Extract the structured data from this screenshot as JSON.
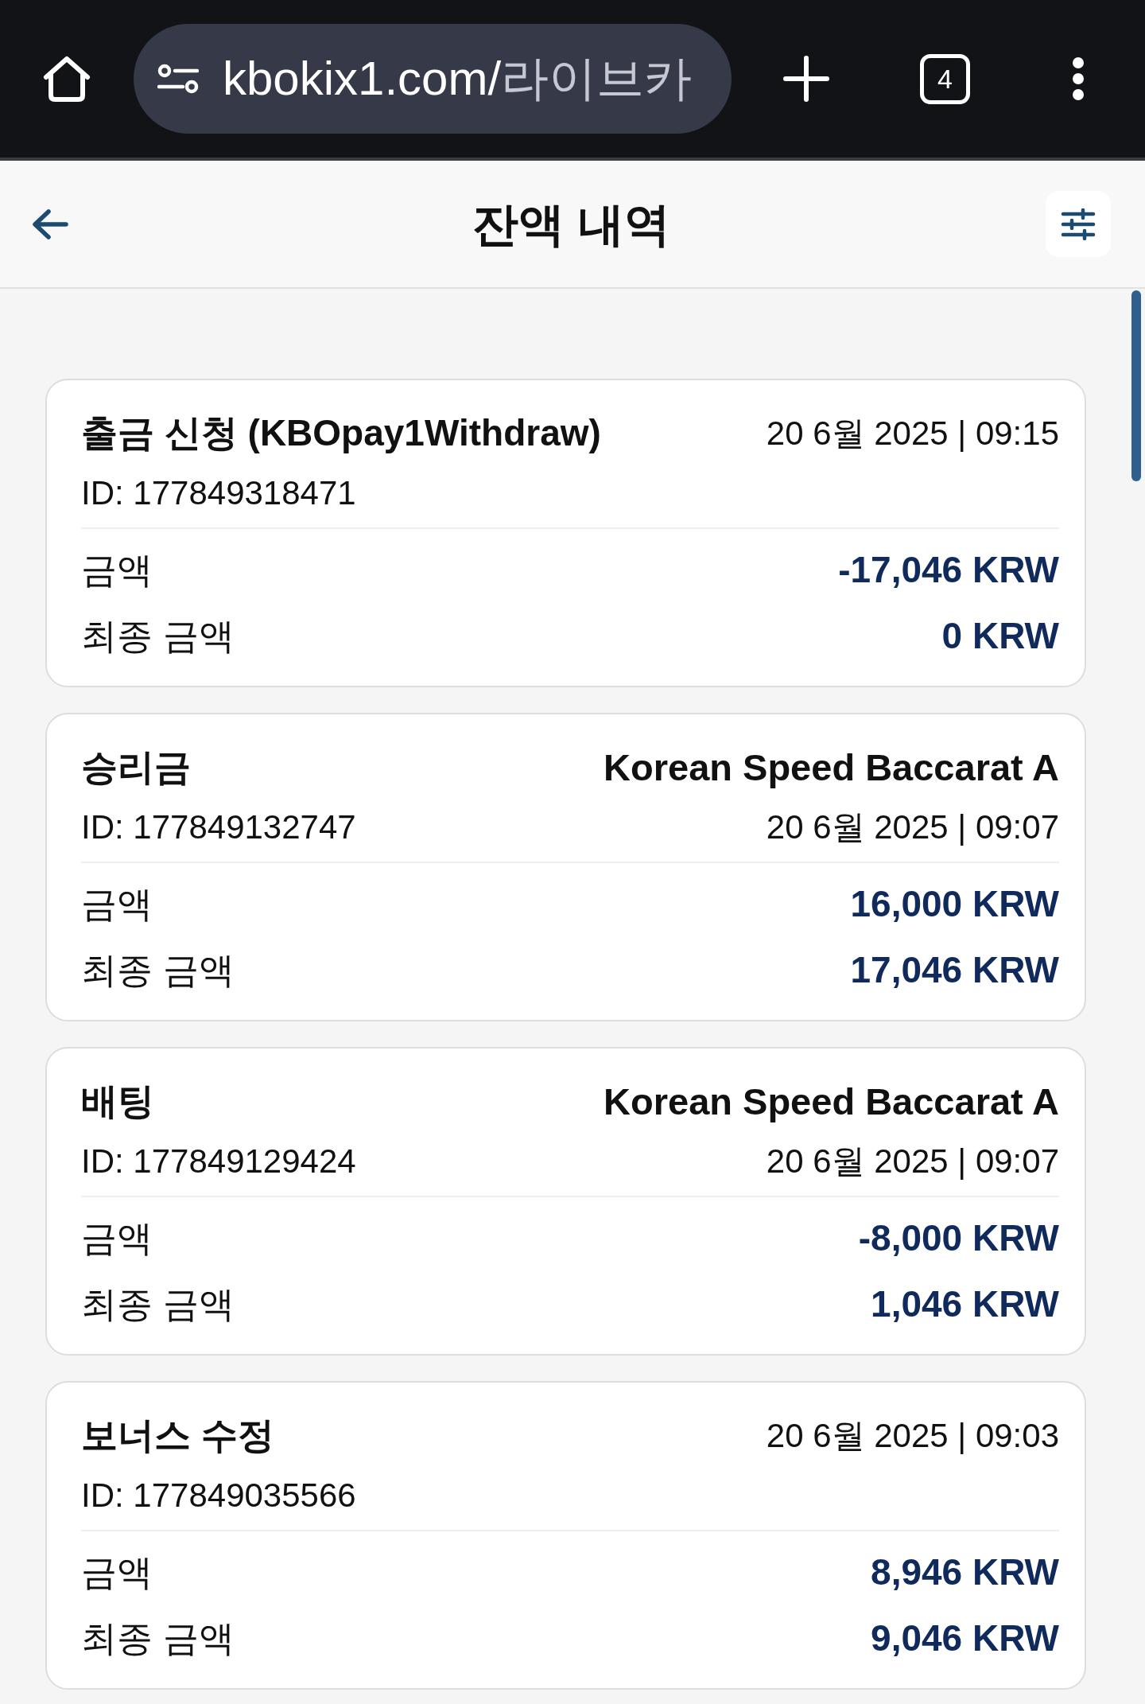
{
  "browser": {
    "address": {
      "domain": "kbokix1.com/",
      "path": "라이브카"
    },
    "tab_count": "4"
  },
  "header": {
    "title": "잔액 내역"
  },
  "transactions": [
    {
      "title": "출금 신청 (KBOpay1Withdraw)",
      "id": "ID: 177849318471",
      "date": "20 6월 2025 | 09:15",
      "rows": [
        {
          "label": "금액",
          "value": "-17,046 KRW"
        },
        {
          "label": "최종 금액",
          "value": "0 KRW"
        }
      ]
    },
    {
      "title": "승리금",
      "game": "Korean Speed Baccarat A",
      "id": "ID: 177849132747",
      "date": "20 6월 2025 | 09:07",
      "rows": [
        {
          "label": "금액",
          "value": "16,000 KRW"
        },
        {
          "label": "최종 금액",
          "value": "17,046 KRW"
        }
      ]
    },
    {
      "title": "배팅",
      "game": "Korean Speed Baccarat A",
      "id": "ID: 177849129424",
      "date": "20 6월 2025 | 09:07",
      "rows": [
        {
          "label": "금액",
          "value": "-8,000 KRW"
        },
        {
          "label": "최종 금액",
          "value": "1,046 KRW"
        }
      ]
    },
    {
      "title": "보너스 수정",
      "id": "ID: 177849035566",
      "date": "20 6월 2025 | 09:03",
      "rows": [
        {
          "label": "금액",
          "value": "8,946 KRW"
        },
        {
          "label": "최종 금액",
          "value": "9,046 KRW"
        }
      ]
    }
  ]
}
